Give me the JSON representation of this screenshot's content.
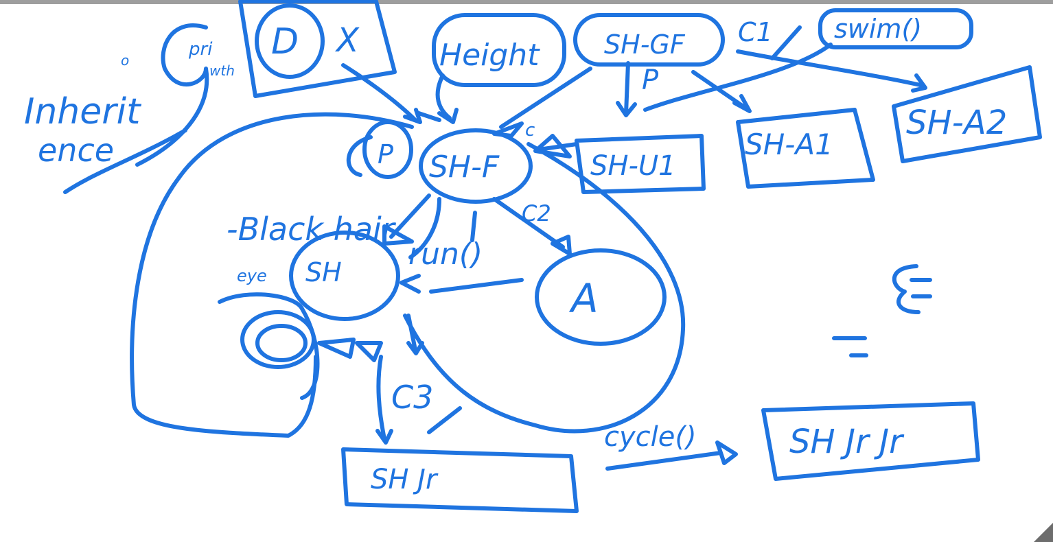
{
  "ink_color": "#1f74e0",
  "labels": {
    "inherit": "Inherit",
    "ence": "ence",
    "pri": "pri",
    "o_mark": "o",
    "wth": "wth",
    "d": "D",
    "x": "X",
    "height": "Height",
    "sh_gf": "SH-GF",
    "c1": "C1",
    "swim": "swim()",
    "p_top": "P",
    "p_left": "P",
    "c_top": "c",
    "sh_f": "SH-F",
    "sh_u1": "SH-U1",
    "sh_a1": "SH-A1",
    "sh_a2": "SH-A2",
    "black_hair": "-Black hair",
    "eye": "eye",
    "c2": "C2",
    "run": "run()",
    "sh": "SH",
    "a": "A",
    "c3": "C3",
    "sh_jr": "SH Jr",
    "cycle": "cycle()",
    "sh_jr_jr": "SH Jr Jr"
  }
}
